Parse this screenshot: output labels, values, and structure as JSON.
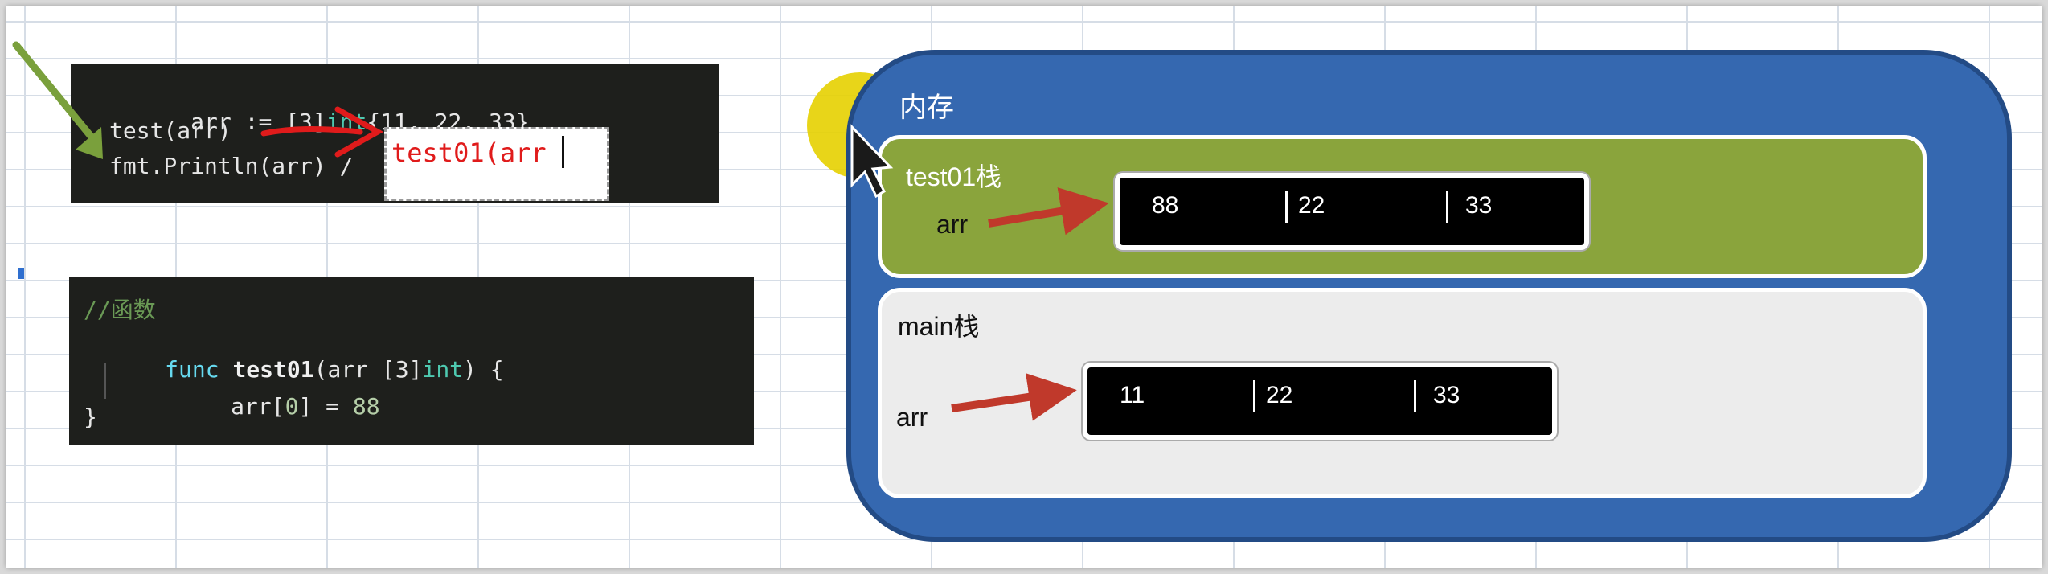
{
  "code_top": {
    "line1": {
      "a": "arr := [3]",
      "b": "int",
      "c": "{11, 22, 33}"
    },
    "line2": "test(arr)",
    "line3": "fmt.Println(arr) /"
  },
  "tooltip": {
    "text": "test01(arr"
  },
  "code_bottom": {
    "comment": "//函数",
    "line2": {
      "kw": "func",
      "fn": "test01",
      "p1": "(arr [3]",
      "ty": "int",
      "p2": ") {"
    },
    "line3": {
      "a": "arr[",
      "n1": "0",
      "b": "] = ",
      "n2": "88"
    },
    "line4": "}"
  },
  "memory": {
    "title": "内存",
    "test01_stack": {
      "title": "test01栈",
      "var": "arr",
      "values": [
        "88",
        "22",
        "33"
      ]
    },
    "main_stack": {
      "title": "main栈",
      "var": "arr",
      "values": [
        "11",
        "22",
        "33"
      ]
    }
  },
  "colors": {
    "memory_bg": "#3568b0",
    "test01_stack_bg": "#8aa43c",
    "main_stack_bg": "#ececec",
    "arrow_red": "#c0392b",
    "arrow_green": "#7aa03c",
    "highlight_yellow": "#e5d000"
  },
  "icons": [
    "mouse-cursor-icon"
  ]
}
